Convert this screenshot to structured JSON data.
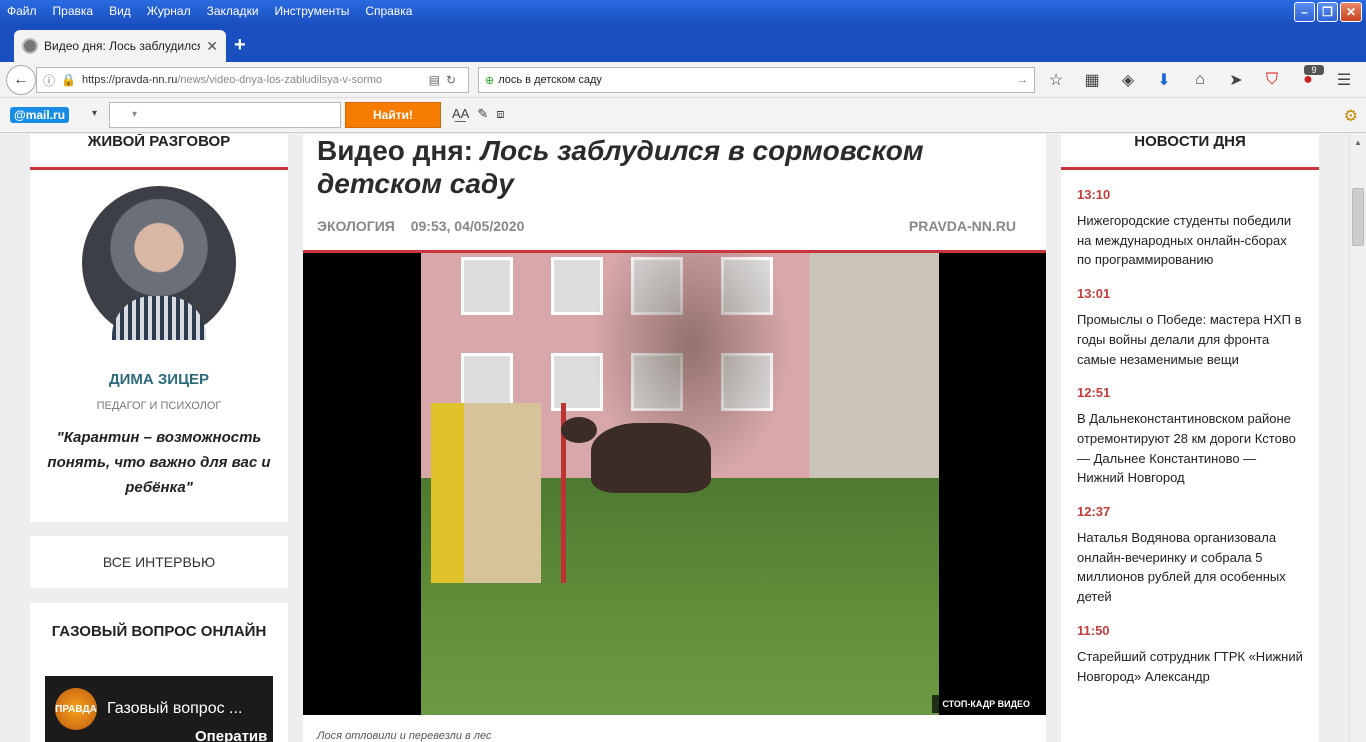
{
  "menu": [
    "Файл",
    "Правка",
    "Вид",
    "Журнал",
    "Закладки",
    "Инструменты",
    "Справка"
  ],
  "tab": {
    "title": "Видео дня: Лось заблудился..."
  },
  "address": {
    "prefix": "https://pravda-nn.ru",
    "path": "/news/video-dnya-los-zabludilsya-v-sormo"
  },
  "search": {
    "value": "лось в детском саду"
  },
  "abp_badge": "9",
  "mailbar": {
    "logo": "@mail.ru",
    "find_label": "Найти!"
  },
  "left": {
    "interview_head": "ЖИВОЙ РАЗГОВОР",
    "person_name": "ДИМА ЗИЦЕР",
    "person_role": "ПЕДАГОГ И ПСИХОЛОГ",
    "quote": "\"Карантин – возможность понять, что важно для вас и ребёнка\"",
    "all_interviews": "ВСЕ ИНТЕРВЬЮ",
    "gas_title": "ГАЗОВЫЙ ВОПРОС ОНЛАЙН",
    "gas_logo": "ПРАВДА",
    "gas_video_title": "Газовый вопрос ...",
    "gas_video_sub": "Оператив"
  },
  "article": {
    "title_part1": "Видео дня: ",
    "title_part2": "Лось заблудился в сормовском детском саду",
    "category": "ЭКОЛОГИЯ",
    "datetime": "09:53, 04/05/2020",
    "source": "PRAVDA-NN.RU",
    "badge": "СТОП-КАДР ВИДЕО",
    "caption": "Лося отловили и перевезли в лес"
  },
  "news": {
    "head": "НОВОСТИ ДНЯ",
    "items": [
      {
        "time": "13:10",
        "text": "Нижегородские студенты победили на международных онлайн-сборах по программированию"
      },
      {
        "time": "13:01",
        "text": "Промыслы о Победе: мастера НХП в годы войны делали для фронта самые незаменимые вещи"
      },
      {
        "time": "12:51",
        "text": "В Дальнеконстантиновском районе отремонтируют 28 км дороги Кстово — Дальнее Константиново — Нижний Новгород"
      },
      {
        "time": "12:37",
        "text": "Наталья Водянова организовала онлайн-вечеринку и собрала 5 миллионов рублей для особенных детей"
      },
      {
        "time": "11:50",
        "text": "Старейший сотрудник ГТРК «Нижний Новгород» Александр"
      }
    ]
  }
}
